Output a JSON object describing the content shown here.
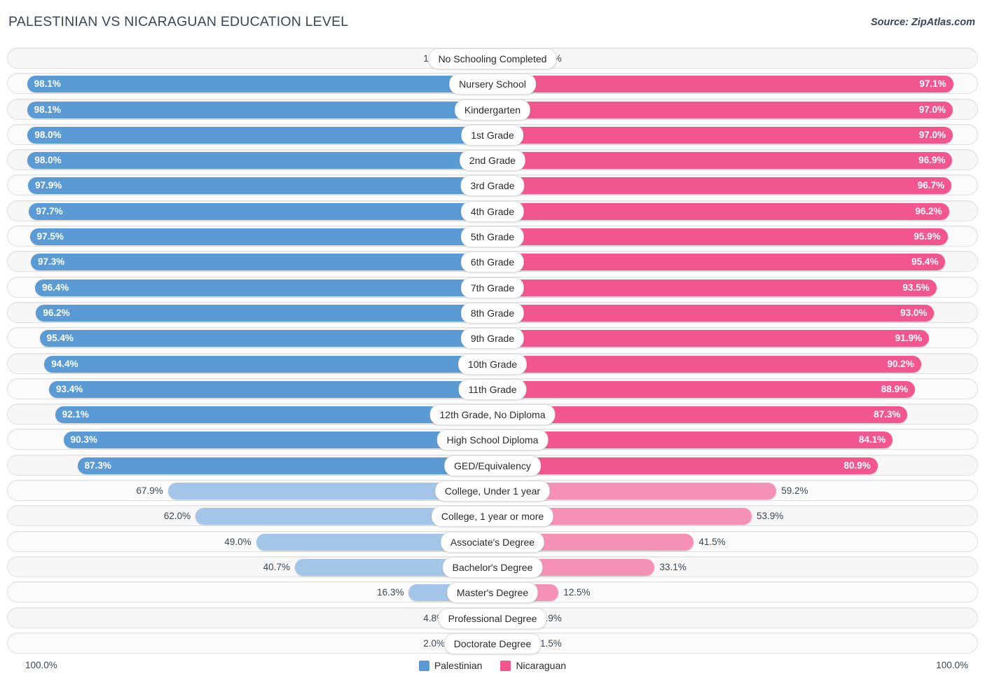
{
  "header": {
    "title": "PALESTINIAN VS NICARAGUAN EDUCATION LEVEL",
    "source": "Source: ZipAtlas.com"
  },
  "legend": {
    "series": [
      {
        "name": "Palestinian",
        "color": "#5B9BD5"
      },
      {
        "name": "Nicaraguan",
        "color": "#F2568F"
      }
    ]
  },
  "footer": {
    "axis_min": "100.0%",
    "axis_max": "100.0%"
  },
  "colors": {
    "blue_strong": "#5B9BD5",
    "blue_light": "#A3C6E8",
    "pink_strong": "#F2568F",
    "pink_light": "#F591B5",
    "track": "#F7F7F7",
    "track_border": "#E2E2E2",
    "text": "#3B4652"
  },
  "chart_data": {
    "type": "bar",
    "title": "PALESTINIAN VS NICARAGUAN EDUCATION LEVEL",
    "orientation": "horizontal-diverging",
    "xlabel": "",
    "ylabel": "",
    "xlim": [
      0,
      100
    ],
    "unit": "%",
    "grid": false,
    "legend_position": "bottom-center",
    "categories": [
      "No Schooling Completed",
      "Nursery School",
      "Kindergarten",
      "1st Grade",
      "2nd Grade",
      "3rd Grade",
      "4th Grade",
      "5th Grade",
      "6th Grade",
      "7th Grade",
      "8th Grade",
      "9th Grade",
      "10th Grade",
      "11th Grade",
      "12th Grade, No Diploma",
      "High School Diploma",
      "GED/Equivalency",
      "College, Under 1 year",
      "College, 1 year or more",
      "Associate's Degree",
      "Bachelor's Degree",
      "Master's Degree",
      "Professional Degree",
      "Doctorate Degree"
    ],
    "series": [
      {
        "name": "Palestinian",
        "color": "#5B9BD5",
        "values": [
          1.9,
          98.1,
          98.1,
          98.0,
          98.0,
          97.9,
          97.7,
          97.5,
          97.3,
          96.4,
          96.2,
          95.4,
          94.4,
          93.4,
          92.1,
          90.3,
          87.3,
          67.9,
          62.0,
          49.0,
          40.7,
          16.3,
          4.8,
          2.0
        ],
        "labels": [
          "1.9%",
          "98.1%",
          "98.1%",
          "98.0%",
          "98.0%",
          "97.9%",
          "97.7%",
          "97.5%",
          "97.3%",
          "96.4%",
          "96.2%",
          "95.4%",
          "94.4%",
          "93.4%",
          "92.1%",
          "90.3%",
          "87.3%",
          "67.9%",
          "62.0%",
          "49.0%",
          "40.7%",
          "16.3%",
          "4.8%",
          "2.0%"
        ]
      },
      {
        "name": "Nicaraguan",
        "color": "#F2568F",
        "values": [
          2.9,
          97.1,
          97.0,
          97.0,
          96.9,
          96.7,
          96.2,
          95.9,
          95.4,
          93.5,
          93.0,
          91.9,
          90.2,
          88.9,
          87.3,
          84.1,
          80.9,
          59.2,
          53.9,
          41.5,
          33.1,
          12.5,
          3.9,
          1.5
        ],
        "labels": [
          "2.9%",
          "97.1%",
          "97.0%",
          "97.0%",
          "96.9%",
          "96.7%",
          "96.2%",
          "95.9%",
          "95.4%",
          "93.5%",
          "93.0%",
          "91.9%",
          "90.2%",
          "88.9%",
          "87.3%",
          "84.1%",
          "80.9%",
          "59.2%",
          "53.9%",
          "41.5%",
          "33.1%",
          "12.5%",
          "3.9%",
          "1.5%"
        ]
      }
    ]
  }
}
